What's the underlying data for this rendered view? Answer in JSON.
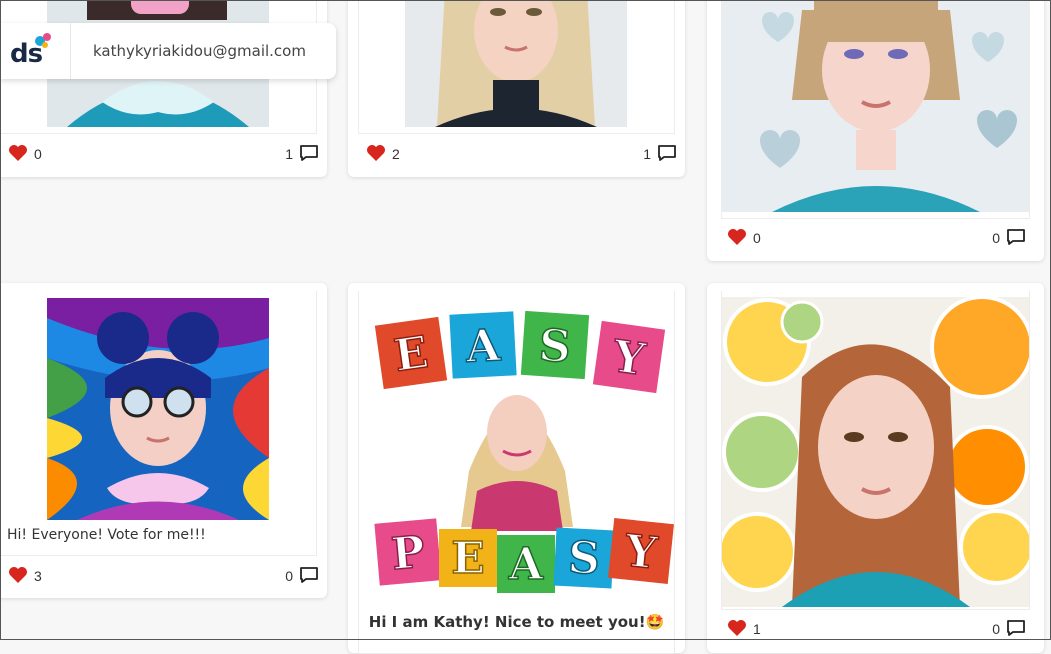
{
  "header": {
    "logo_text": "ds",
    "email": "kathykyriakidou@gmail.com"
  },
  "icons": {
    "like": "heart-icon",
    "comment": "comment-icon"
  },
  "colors": {
    "heart": "#d7261e",
    "accent_blue": "#1aa6d8",
    "accent_pink": "#e84b8a"
  },
  "posts": [
    {
      "likes": "0",
      "comments": "1",
      "caption": ""
    },
    {
      "likes": "2",
      "comments": "1",
      "caption": ""
    },
    {
      "likes": "0",
      "comments": "0",
      "caption": ""
    },
    {
      "likes": "3",
      "comments": "0",
      "caption": "Hi! Everyone! Vote for me!!!"
    },
    {
      "likes": "",
      "comments": "",
      "caption": "Hi I am Kathy! Nice to meet you!🤩",
      "image_text": [
        "E",
        "A",
        "S",
        "Y",
        "P",
        "E",
        "A",
        "S",
        "Y"
      ]
    },
    {
      "likes": "1",
      "comments": "0",
      "caption": ""
    }
  ]
}
